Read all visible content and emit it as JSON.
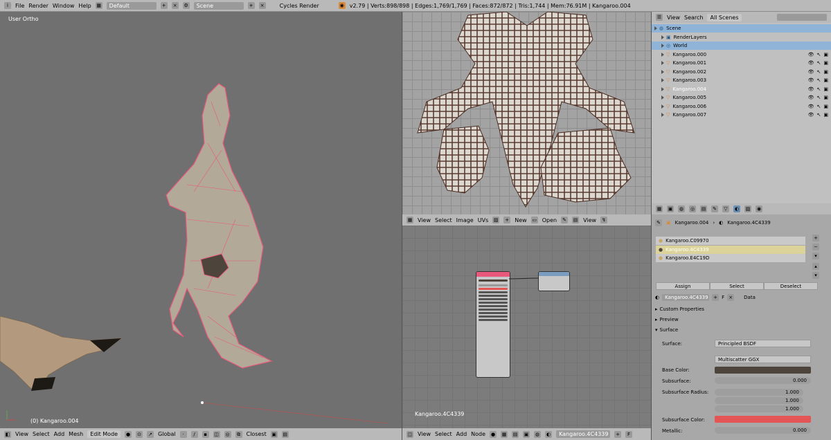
{
  "topbar": {
    "menus": [
      "File",
      "Render",
      "Window",
      "Help"
    ],
    "layout": "Default",
    "scene": "Scene",
    "engine": "Cycles Render",
    "stats": "v2.79 | Verts:898/898 | Edges:1,769/1,769 | Faces:872/872 | Tris:1,744 | Mem:76.91M | Kangaroo.004"
  },
  "viewport": {
    "view_label": "User Ortho",
    "object_label": "(0) Kangaroo.004",
    "menus": [
      "View",
      "Select",
      "Add",
      "Mesh"
    ],
    "mode": "Edit Mode",
    "orientation": "Global",
    "snap": "Closest"
  },
  "uv_editor": {
    "menus": [
      "View",
      "Select",
      "Image",
      "UVs"
    ],
    "new_label": "New",
    "open_label": "Open",
    "view_label": "View"
  },
  "node_editor": {
    "material_label": "Kangaroo.4C4339",
    "menus": [
      "View",
      "Select",
      "Add",
      "Node"
    ],
    "material_field": "Kangaroo.4C4339"
  },
  "outliner": {
    "menus": [
      "View",
      "Search"
    ],
    "filter": "All Scenes",
    "items": [
      {
        "label": "Scene",
        "selected": true,
        "level": 0
      },
      {
        "label": "RenderLayers",
        "selected": false,
        "level": 1
      },
      {
        "label": "World",
        "selected": true,
        "level": 1
      },
      {
        "label": "Kangaroo.000",
        "selected": false,
        "level": 1
      },
      {
        "label": "Kangaroo.001",
        "selected": false,
        "level": 1
      },
      {
        "label": "Kangaroo.002",
        "selected": false,
        "level": 1
      },
      {
        "label": "Kangaroo.003",
        "selected": false,
        "level": 1
      },
      {
        "label": "Kangaroo.004",
        "selected": false,
        "level": 1
      },
      {
        "label": "Kangaroo.005",
        "selected": false,
        "level": 1
      },
      {
        "label": "Kangaroo.006",
        "selected": false,
        "level": 1
      },
      {
        "label": "Kangaroo.007",
        "selected": false,
        "level": 1
      }
    ]
  },
  "properties": {
    "breadcrumb_object": "Kangaroo.004",
    "breadcrumb_material": "Kangaroo.4C4339",
    "slots": [
      "Kangaroo.C09970",
      "Kangaroo.4C4339",
      "Kangaroo.E4C19D"
    ],
    "assign": "Assign",
    "select": "Select",
    "deselect": "Deselect",
    "material_name": "Kangaroo.4C4339",
    "f_label": "F",
    "data_label": "Data",
    "panels": [
      "Custom Properties",
      "Preview",
      "Surface"
    ],
    "surface_label": "Surface:",
    "surface_value": "Principled BSDF",
    "distribution": "Multiscatter GGX",
    "base_color_label": "Base Color:",
    "subsurface_label": "Subsurface:",
    "subsurface_value": "0.000",
    "subsurface_radius_label": "Subsurface Radius:",
    "radius_values": [
      "1.000",
      "1.000",
      "1.000"
    ],
    "subsurface_color_label": "Subsurface Color:",
    "metallic_label": "Metallic:",
    "metallic_value": "0.000"
  },
  "colors": {
    "accent": "#e8587a",
    "base_color": "#4d443b",
    "subsurface_color": "#e45656",
    "selected_row": "#8fb4d8",
    "slot_active": "#dbd39a"
  }
}
